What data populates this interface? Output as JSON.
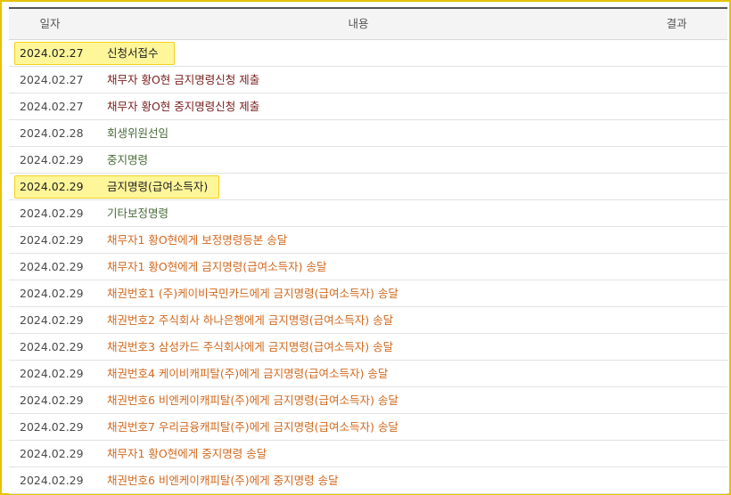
{
  "header": {
    "date": "일자",
    "content": "내용",
    "result": "결과"
  },
  "rows": [
    {
      "date": "2024.02.27",
      "content": "신청서접수",
      "color": "black",
      "highlight": true,
      "hlw": 178
    },
    {
      "date": "2024.02.27",
      "content": "채무자 황O현 금지명령신청 제출",
      "color": "dark"
    },
    {
      "date": "2024.02.27",
      "content": "채무자 황O현 중지명령신청 제출",
      "color": "dark"
    },
    {
      "date": "2024.02.28",
      "content": "회생위원선임",
      "color": "green"
    },
    {
      "date": "2024.02.29",
      "content": "중지명령",
      "color": "green"
    },
    {
      "date": "2024.02.29",
      "content": "금지명령(급여소득자)",
      "color": "black",
      "highlight": true,
      "hlw": 228
    },
    {
      "date": "2024.02.29",
      "content": "기타보정명령",
      "color": "green"
    },
    {
      "date": "2024.02.29",
      "content": "채무자1 황O현에게 보정명령등본 송달",
      "color": "orange"
    },
    {
      "date": "2024.02.29",
      "content": "채무자1 황O현에게 금지명령(급여소득자) 송달",
      "color": "orange"
    },
    {
      "date": "2024.02.29",
      "content": "채권번호1 (주)케이비국민카드에게 금지명령(급여소득자) 송달",
      "color": "orange"
    },
    {
      "date": "2024.02.29",
      "content": "채권번호2 주식회사 하나은행에게 금지명령(급여소득자) 송달",
      "color": "orange"
    },
    {
      "date": "2024.02.29",
      "content": "채권번호3 삼성카드 주식회사에게 금지명령(급여소득자) 송달",
      "color": "orange"
    },
    {
      "date": "2024.02.29",
      "content": "채권번호4 케이비캐피탈(주)에게 금지명령(급여소득자) 송달",
      "color": "orange"
    },
    {
      "date": "2024.02.29",
      "content": "채권번호6 비엔케이캐피탈(주)에게 금지명령(급여소득자) 송달",
      "color": "orange"
    },
    {
      "date": "2024.02.29",
      "content": "채권번호7 우리금융캐피탈(주)에게 금지명령(급여소득자) 송달",
      "color": "orange"
    },
    {
      "date": "2024.02.29",
      "content": "채무자1 황O현에게 중지명령 송달",
      "color": "orange"
    },
    {
      "date": "2024.02.29",
      "content": "채권번호6 비엔케이캐피탈(주)에게 중지명령 송달",
      "color": "orange"
    }
  ]
}
